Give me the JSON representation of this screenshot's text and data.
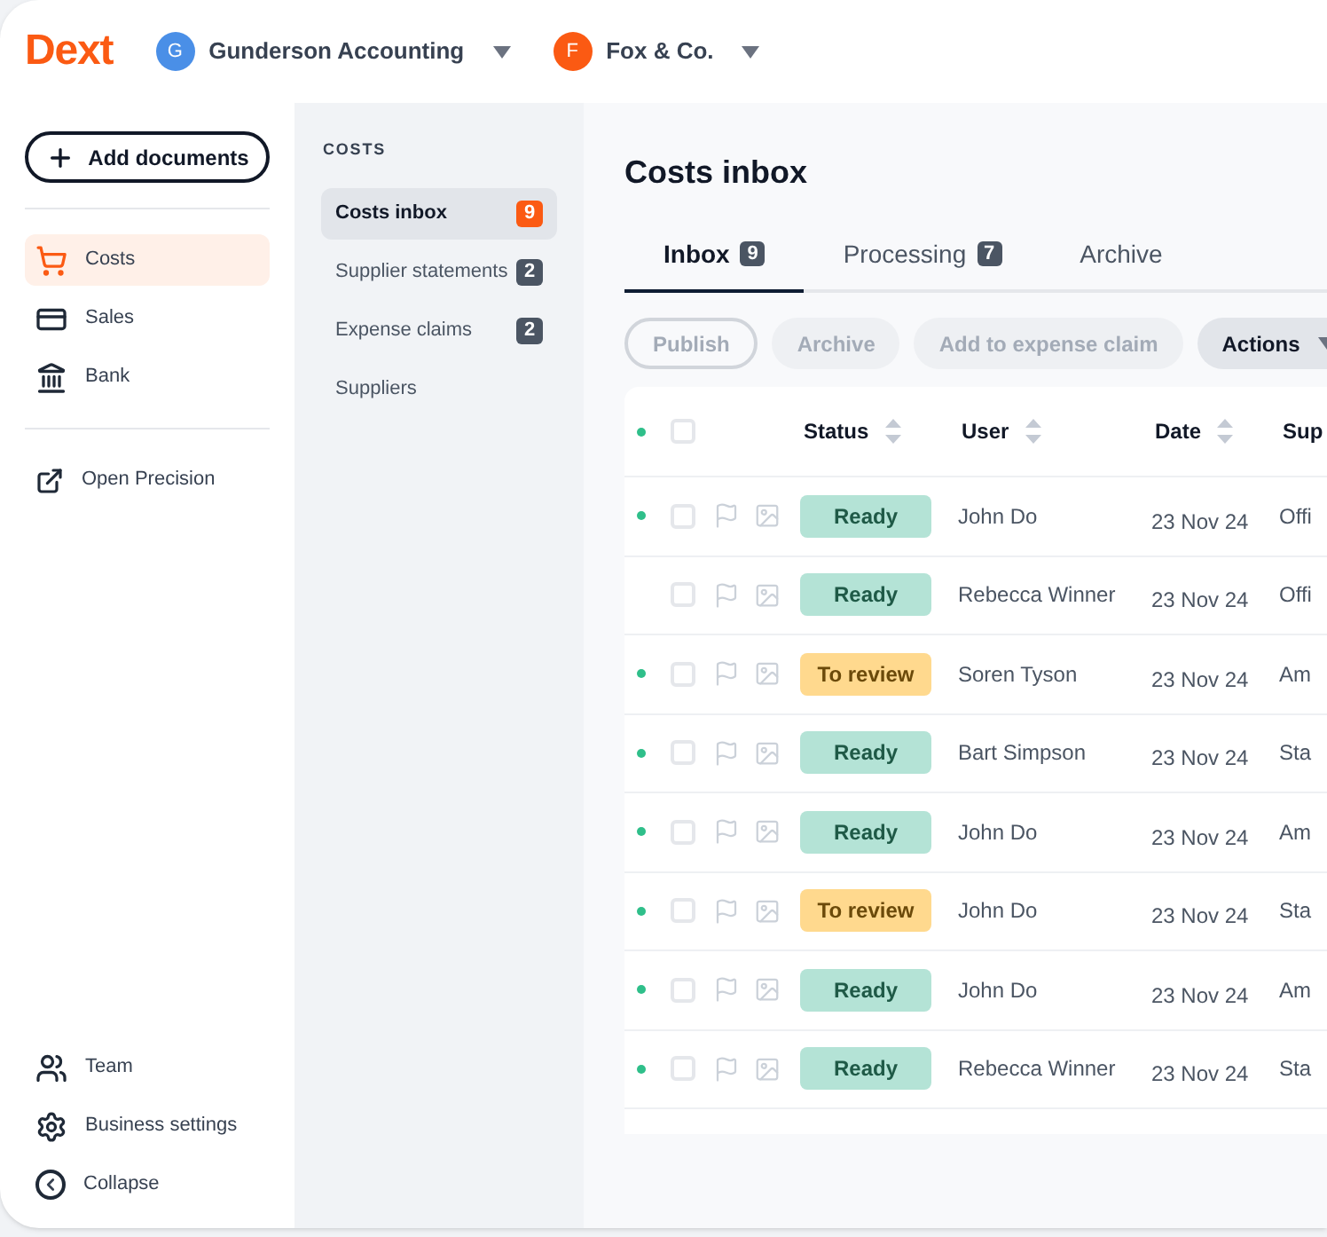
{
  "topbar": {
    "logo": "Dext",
    "accounts": [
      {
        "initial": "G",
        "name": "Gunderson Accounting",
        "color": "#4a8fe7"
      },
      {
        "initial": "F",
        "name": "Fox & Co.",
        "color": "#fb5a13"
      }
    ]
  },
  "sidebar": {
    "add_button": "Add documents",
    "items": [
      {
        "label": "Costs",
        "selected": true
      },
      {
        "label": "Sales",
        "selected": false
      },
      {
        "label": "Bank",
        "selected": false
      }
    ],
    "external": {
      "label": "Open Precision"
    },
    "bottom_items": [
      {
        "label": "Team"
      },
      {
        "label": "Business settings"
      },
      {
        "label": "Collapse"
      }
    ]
  },
  "subnav": {
    "heading": "COSTS",
    "items": [
      {
        "label": "Costs inbox",
        "count": "9",
        "selected": true
      },
      {
        "label": "Supplier statements",
        "count": "2",
        "selected": false
      },
      {
        "label": "Expense claims",
        "count": "2",
        "selected": false
      },
      {
        "label": "Suppliers",
        "selected": false
      }
    ]
  },
  "page_title": "Costs inbox",
  "tabs": [
    {
      "label": "Inbox",
      "count": "9",
      "selected": true
    },
    {
      "label": "Processing",
      "count": "7",
      "selected": false
    },
    {
      "label": "Archive",
      "selected": false
    }
  ],
  "actions": [
    {
      "label": "Publish",
      "kind": "outline",
      "disabled": true
    },
    {
      "label": "Archive",
      "kind": "filled",
      "disabled": true
    },
    {
      "label": "Add to expense claim",
      "kind": "filled",
      "disabled": true
    },
    {
      "label": "Actions",
      "kind": "menu",
      "disabled": false
    }
  ],
  "table": {
    "all_checked": false,
    "columns": [
      "Status",
      "User",
      "Date",
      "Sup"
    ],
    "rows": [
      {
        "unread": true,
        "checked": false,
        "status": "Ready",
        "kind": "ready",
        "user": "John Do",
        "date": "23 Nov 24",
        "supplier": "Offi"
      },
      {
        "unread": false,
        "checked": false,
        "status": "Ready",
        "kind": "ready",
        "user": "Rebecca Winner",
        "date": "23 Nov 24",
        "supplier": "Offi"
      },
      {
        "unread": true,
        "checked": false,
        "status": "To review",
        "kind": "review",
        "user": "Soren Tyson",
        "date": "23 Nov 24",
        "supplier": "Am"
      },
      {
        "unread": true,
        "checked": false,
        "status": "Ready",
        "kind": "ready",
        "user": "Bart Simpson",
        "date": "23 Nov 24",
        "supplier": "Sta"
      },
      {
        "unread": true,
        "checked": false,
        "status": "Ready",
        "kind": "ready",
        "user": "John Do",
        "date": "23 Nov 24",
        "supplier": "Am"
      },
      {
        "unread": true,
        "checked": false,
        "status": "To review",
        "kind": "review",
        "user": "John Do",
        "date": "23 Nov 24",
        "supplier": "Sta"
      },
      {
        "unread": true,
        "checked": false,
        "status": "Ready",
        "kind": "ready",
        "user": "John Do",
        "date": "23 Nov 24",
        "supplier": "Am"
      },
      {
        "unread": true,
        "checked": false,
        "status": "Ready",
        "kind": "ready",
        "user": "Rebecca Winner",
        "date": "23 Nov 24",
        "supplier": "Sta"
      }
    ]
  }
}
